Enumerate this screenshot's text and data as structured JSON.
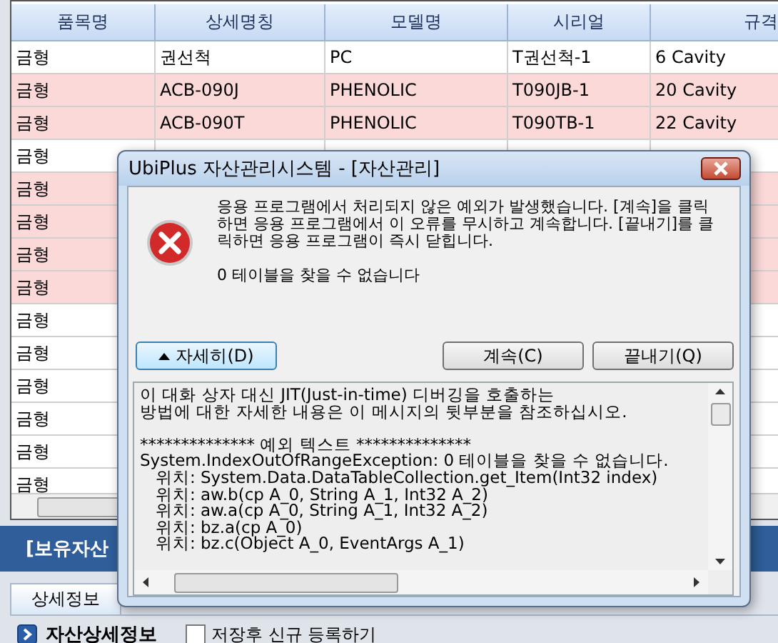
{
  "grid": {
    "columns": [
      "품목명",
      "상세명칭",
      "모델명",
      "시리얼",
      "규격"
    ],
    "rows": [
      {
        "highlighted": false,
        "cells": [
          "금형",
          "권선척",
          "PC",
          "T권선척-1",
          "6 Cavity"
        ]
      },
      {
        "highlighted": true,
        "cells": [
          "금형",
          "ACB-090J",
          "PHENOLIC",
          "T090JB-1",
          "20 Cavity"
        ]
      },
      {
        "highlighted": true,
        "cells": [
          "금형",
          "ACB-090T",
          "PHENOLIC",
          "T090TB-1",
          "22 Cavity"
        ]
      },
      {
        "highlighted": false,
        "cells": [
          "금형"
        ]
      },
      {
        "highlighted": true,
        "cells": [
          "금형"
        ]
      },
      {
        "highlighted": true,
        "cells": [
          "금형"
        ]
      },
      {
        "highlighted": true,
        "cells": [
          "금형"
        ]
      },
      {
        "highlighted": true,
        "cells": [
          "금형"
        ]
      },
      {
        "highlighted": false,
        "cells": [
          "금형"
        ]
      },
      {
        "highlighted": false,
        "cells": [
          "금형"
        ]
      },
      {
        "highlighted": false,
        "cells": [
          "금형"
        ]
      },
      {
        "highlighted": false,
        "cells": [
          "금형"
        ]
      },
      {
        "highlighted": false,
        "cells": [
          "금형"
        ]
      },
      {
        "highlighted": false,
        "cells": [
          "금형"
        ]
      }
    ]
  },
  "section_band": {
    "title": "[보유자산"
  },
  "tabs": [
    {
      "label": "상세정보",
      "selected": true
    }
  ],
  "detail_header": {
    "title": "자산상세정보",
    "checkbox": {
      "label": "저장후 신규 등록하기",
      "checked": false
    }
  },
  "dialog": {
    "title": "UbiPlus 자산관리시스템 - [자산관리]",
    "message": "응용 프로그램에서 처리되지 않은 예외가 발생했습니다. [계속]을 클릭하면 응용 프로그램에서 이 오류를 무시하고 계속합니다. [끝내기]를 클릭하면 응용 프로그램이 즉시 닫힙니다.",
    "error": "0 테이블을 찾을 수 없습니다",
    "buttons": [
      {
        "kind": "details",
        "label": "자세히(D)"
      },
      {
        "kind": "action",
        "label": "계속(C)"
      },
      {
        "kind": "action",
        "label": "끝내기(Q)"
      }
    ],
    "details": [
      [
        "이 대화 상자 대신 JIT(Just-in-time) 디버깅을 호출하는",
        "방법에 대한 자세한 내용은 이 메시지의 뒷부분을 참조하십시오."
      ],
      [
        "************** 예외 텍스트 **************",
        "System.IndexOutOfRangeException: 0 테이블을 찾을 수 없습니다.",
        "   위치: System.Data.DataTableCollection.get_Item(Int32 index)",
        "   위치: aw.b(cp A_0, String A_1, Int32 A_2)",
        "   위치: aw.a(cp A_0, String A_1, Int32 A_2)",
        "   위치: bz.a(cp A_0)",
        "   위치: bz.c(Object A_0, EventArgs A_1)"
      ]
    ]
  }
}
